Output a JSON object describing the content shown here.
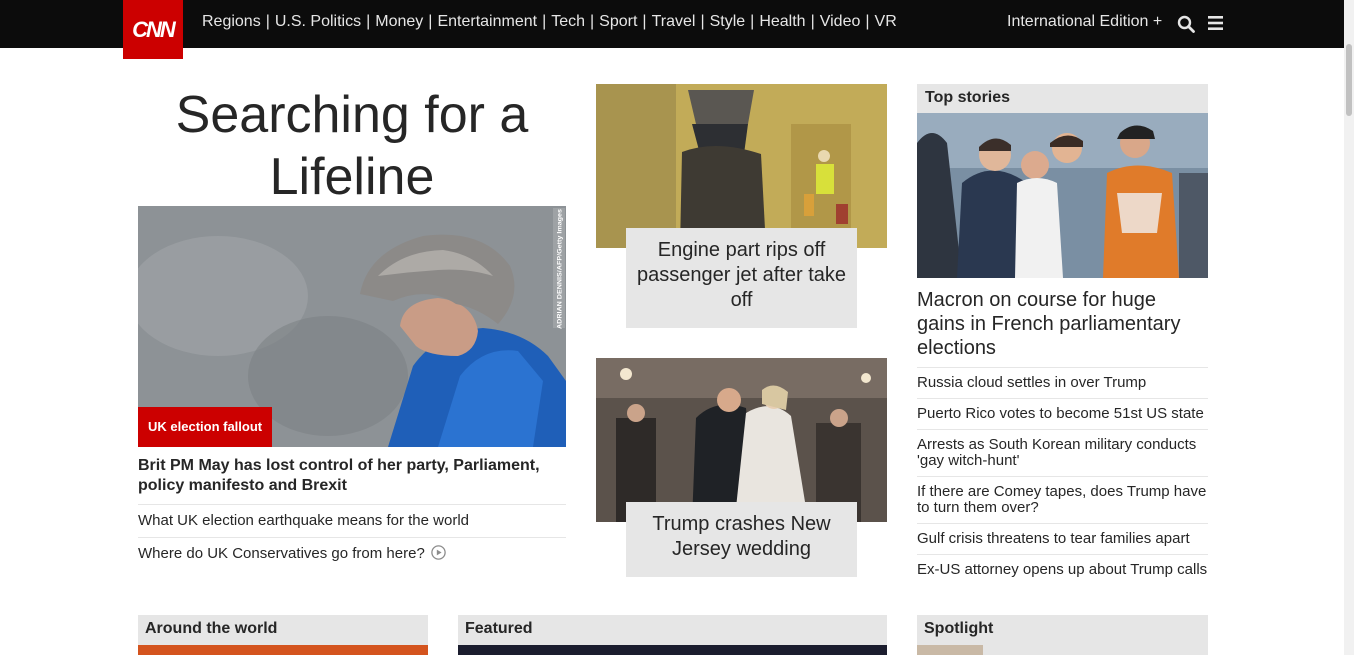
{
  "nav": {
    "logo": "CNN",
    "links": [
      "Regions",
      "U.S. Politics",
      "Money",
      "Entertainment",
      "Tech",
      "Sport",
      "Travel",
      "Style",
      "Health",
      "Video",
      "VR"
    ],
    "edition": "International Edition +",
    "search_icon": "search-icon",
    "menu_icon": "hamburger-menu-icon"
  },
  "lead": {
    "headline": "Searching for a Lifeline",
    "label": "UK election fallout",
    "photo_credit": "ADRIAN DENNIS/AFP/Getty Images",
    "title": "Brit PM May has lost control of her party, Parliament, policy manifesto and Brexit",
    "links": [
      {
        "text": "What UK election earthquake means for the world"
      },
      {
        "text": "Where do UK Conservatives go from here?"
      }
    ]
  },
  "center": {
    "cards": [
      {
        "caption": "Engine part rips off passenger jet after take off"
      },
      {
        "caption": "Trump crashes New Jersey wedding"
      }
    ]
  },
  "top_stories": {
    "header": "Top stories",
    "title": "Macron on course for huge gains in French parliamentary elections",
    "items": [
      "Russia cloud settles in over Trump",
      "Puerto Rico votes to become 51st US state",
      "Arrests as South Korean military conducts 'gay witch-hunt'",
      "If there are Comey tapes, does Trump have to turn them over?",
      "Gulf crisis threatens to tear families apart",
      "Ex-US attorney opens up about Trump calls"
    ]
  },
  "sections": {
    "world": "Around the world",
    "featured": "Featured",
    "spotlight": "Spotlight"
  },
  "colors": {
    "brand_red": "#cc0000",
    "nav_bg": "#0c0c0c",
    "panel_grey": "#e6e6e6"
  }
}
